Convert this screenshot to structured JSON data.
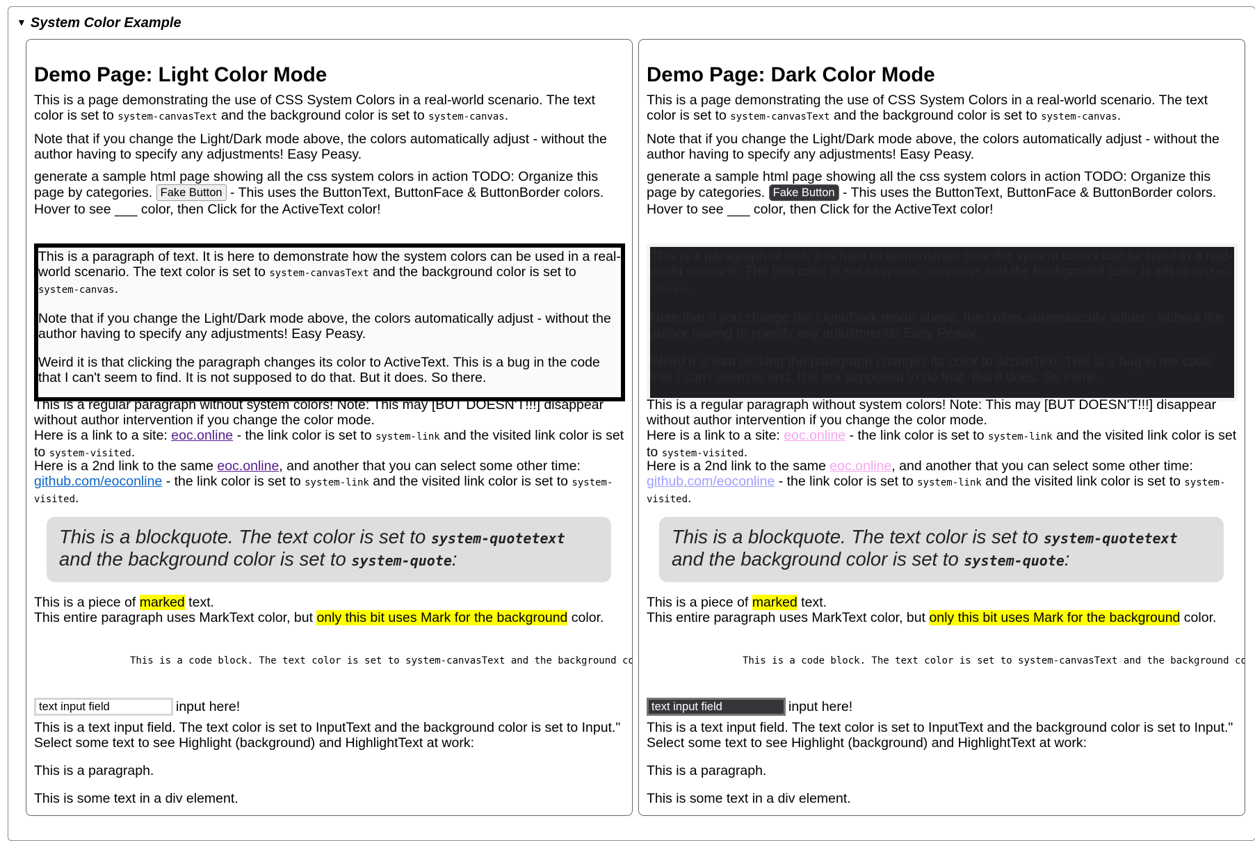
{
  "details": {
    "summary": "System Color Example"
  },
  "panels": [
    {
      "id": "light",
      "title": "Demo Page: Light Color Mode",
      "intro": {
        "part1": "This is a page demonstrating the use of CSS System Colors in a real-world scenario. The text color is set to ",
        "code1": "system-canvasText",
        "part2": " and the background color is set to ",
        "code2": "system-canvas",
        "part3": "."
      },
      "note": "Note that if you change the Light/Dark mode above, the colors automatically adjust - without the author having to specify any adjustments! Easy Peasy.",
      "generate": {
        "part1": "generate a sample html page showing all the css system colors in action TODO: Organize this page by categories. ",
        "button": "Fake Button",
        "part2": " - This uses the ButtonText, ButtonFace & ButtonBorder colors. Hover to see ___ color, then Click for the ActiveText color!"
      },
      "box": {
        "p1_part1": "This is a paragraph of text. It is here to demonstrate how the system colors can be used in a real-world scenario. The text color is set to ",
        "p1_code1": "system-canvasText",
        "p1_part2": " and the background color is set to ",
        "p1_code2": "system-canvas",
        "p1_part3": ".",
        "p2": "Note that if you change the Light/Dark mode above, the colors automatically adjust - without the author having to specify any adjustments! Easy Peasy.",
        "p3": "Weird it is that clicking the paragraph changes its color to ActiveText. This is a bug in the code that I can't seem to find. It is not supposed to do that. But it does. So there."
      },
      "regular": "This is a regular paragraph without system colors! Note: This may [BUT DOESN'T!!!] disappear without author intervention if you change the color mode.",
      "link1": {
        "part1": "Here is a link to a site: ",
        "link": "eoc.online",
        "part2": " - the link color is set to ",
        "code1": "system-link",
        "part3": " and the visited link color is set to ",
        "code2": "system-visited",
        "part4": "."
      },
      "link2": {
        "part1": "Here is a 2nd link to the same ",
        "link": "eoc.online",
        "part2": ", and another that you can select some other time: ",
        "link2": "github.com/eoconline",
        "part3": " - the link color is set to ",
        "code1": "system-link",
        "part4": " and the visited link color is set to ",
        "code2": "system-visited",
        "part5": "."
      },
      "quote": {
        "part1": "This is a blockquote. The text color is set to ",
        "code1": "system-quotetext",
        "part2": " and the background color is set to ",
        "code2": "system-quote",
        "part3": ":"
      },
      "marked": {
        "part1": "This is a piece of ",
        "mark": "marked",
        "part2": " text."
      },
      "marktext": {
        "part1": "This entire paragraph uses MarkText color, but ",
        "mark": "only this bit uses Mark for the background",
        "part2": " color."
      },
      "code": "This is a code block. The text color is set to system-canvasText and the background color is set to system-canvas.",
      "input": {
        "value": "text input field",
        "after": "input here!"
      },
      "input_desc": "This is a text input field. The text color is set to InputText and the background color is set to Input.\"",
      "select_text": "Select some text to see Highlight (background) and HighlightText at work:",
      "para": "This is a paragraph.",
      "div_text": "This is some text in a div element."
    },
    {
      "id": "dark",
      "title": "Demo Page: Dark Color Mode",
      "intro": {
        "part1": "This is a page demonstrating the use of CSS System Colors in a real-world scenario. The text color is set to ",
        "code1": "system-canvasText",
        "part2": " and the background color is set to ",
        "code2": "system-canvas",
        "part3": "."
      },
      "note": "Note that if you change the Light/Dark mode above, the colors automatically adjust - without the author having to specify any adjustments! Easy Peasy.",
      "generate": {
        "part1": "generate a sample html page showing all the css system colors in action TODO: Organize this page by categories. ",
        "button": "Fake Button",
        "part2": " - This uses the ButtonText, ButtonFace & ButtonBorder colors. Hover to see ___ color, then Click for the ActiveText color!"
      },
      "box": {
        "p1_part1": "This is a paragraph of text. It is here to demonstrate how the system colors can be used in a real-world scenario. The text color is set to ",
        "p1_code1": "system-canvasText",
        "p1_part2": " and the background color is set to ",
        "p1_code2": "system-canvas",
        "p1_part3": ".",
        "p2": "Note that if you change the Light/Dark mode above, the colors automatically adjust - without the author having to specify any adjustments! Easy Peasy.",
        "p3": "Weird it is that clicking the paragraph changes its color to ActiveText. This is a bug in the code that I can't seem to find. It is not supposed to do that. But it does. So there."
      },
      "regular": "This is a regular paragraph without system colors! Note: This may [BUT DOESN'T!!!] disappear without author intervention if you change the color mode.",
      "link1": {
        "part1": "Here is a link to a site: ",
        "link": "eoc.online",
        "part2": " - the link color is set to ",
        "code1": "system-link",
        "part3": " and the visited link color is set to ",
        "code2": "system-visited",
        "part4": "."
      },
      "link2": {
        "part1": "Here is a 2nd link to the same ",
        "link": "eoc.online",
        "part2": ", and another that you can select some other time: ",
        "link2": "github.com/eoconline",
        "part3": " - the link color is set to ",
        "code1": "system-link",
        "part4": " and the visited link color is set to ",
        "code2": "system-visited",
        "part5": "."
      },
      "quote": {
        "part1": "This is a blockquote. The text color is set to ",
        "code1": "system-quotetext",
        "part2": " and the background color is set to ",
        "code2": "system-quote",
        "part3": ":"
      },
      "marked": {
        "part1": "This is a piece of ",
        "mark": "marked",
        "part2": " text."
      },
      "marktext": {
        "part1": "This entire paragraph uses MarkText color, but ",
        "mark": "only this bit uses Mark for the background",
        "part2": " color."
      },
      "code": "This is a code block. The text color is set to system-canvasText and the background color is set to system-canvas.",
      "input": {
        "value": "text input field",
        "after": "input here!"
      },
      "input_desc": "This is a text input field. The text color is set to InputText and the background color is set to Input.\"",
      "select_text": "Select some text to see Highlight (background) and HighlightText at work:",
      "para": "This is a paragraph.",
      "div_text": "This is some text in a div element."
    }
  ],
  "colors": {
    "light_box_bg": "#fafafa",
    "dark_box_bg": "#1f1f23",
    "mark": "#ffff00",
    "quote_bg": "#dedede",
    "visited_light": "#551a8b",
    "visited_dark": "#f7a4f2",
    "link_light": "#0b64c9",
    "link_dark": "#9e9eff"
  }
}
